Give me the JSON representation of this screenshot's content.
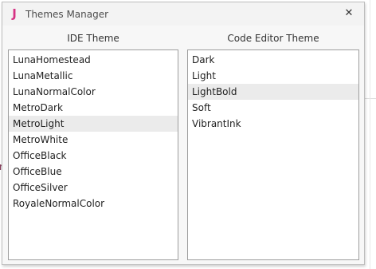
{
  "window": {
    "title": "Themes Manager",
    "close_glyph": "✕",
    "logo_glyph": "J"
  },
  "ide_theme": {
    "header": "IDE Theme",
    "selected": "MetroLight",
    "items": [
      "LunaHomestead",
      "LunaMetallic",
      "LunaNormalColor",
      "MetroDark",
      "MetroLight",
      "MetroWhite",
      "OfficeBlack",
      "OfficeBlue",
      "OfficeSilver",
      "RoyaleNormalColor"
    ]
  },
  "code_editor_theme": {
    "header": "Code Editor Theme",
    "selected": "LightBold",
    "items": [
      "Dark",
      "Light",
      "LightBold",
      "Soft",
      "VibrantInk"
    ]
  },
  "background": {
    "partial_letter": "r"
  },
  "colors": {
    "logo": "#d63384",
    "selection": "#ebebeb",
    "list_border": "#9e9e9e"
  }
}
